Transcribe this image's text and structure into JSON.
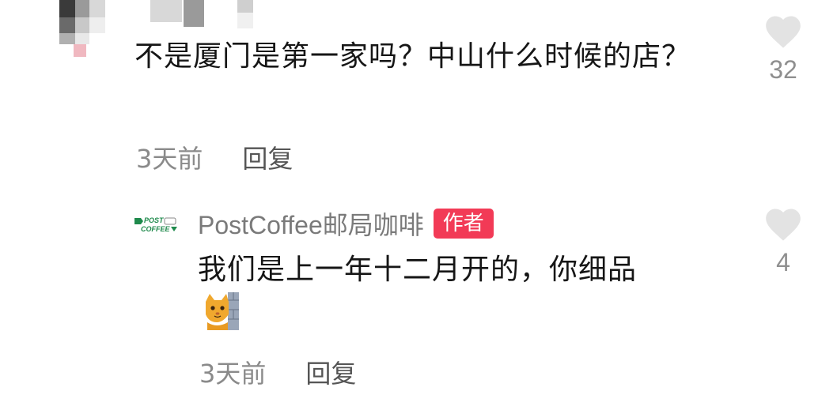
{
  "comment": {
    "text": "不是厦门是第一家吗？中山什么时候的店？",
    "time": "3天前",
    "reply_label": "回复",
    "likes": "32"
  },
  "reply": {
    "author": "PostCoffee邮局咖啡",
    "badge": "作者",
    "text": "我们是上一年十二月开的，你细品",
    "emoji": "cat-peeking-emoji",
    "time": "3天前",
    "reply_label": "回复",
    "likes": "4",
    "logo_text": [
      "POST",
      "COFFEE"
    ]
  },
  "colors": {
    "badge": "#f23a56",
    "heart": "#e3e3e3",
    "brand_green": "#1f8a4c"
  }
}
